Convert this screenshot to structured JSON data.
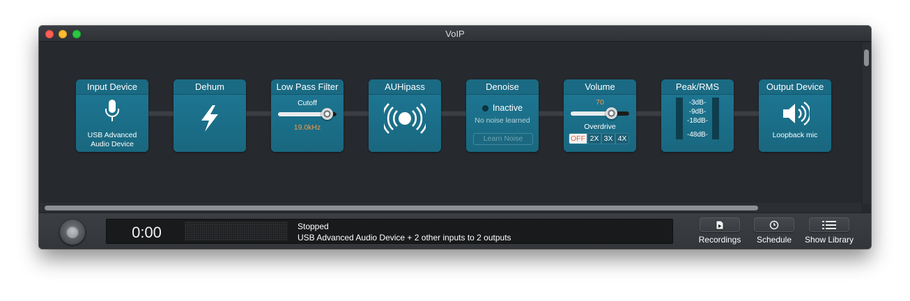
{
  "window": {
    "title": "VoIP"
  },
  "blocks": {
    "input_device": {
      "title": "Input Device",
      "device_line1": "USB Advanced",
      "device_line2": "Audio Device",
      "icon": "microphone-icon"
    },
    "dehum": {
      "title": "Dehum",
      "icon": "lightning-bolt-icon"
    },
    "low_pass_filter": {
      "title": "Low Pass Filter",
      "param_label": "Cutoff",
      "value": "19.0kHz",
      "slider_fraction": 0.84
    },
    "auhipass": {
      "title": "AUHipass",
      "icon": "broadcast-icon"
    },
    "denoise": {
      "title": "Denoise",
      "state": "Inactive",
      "info": "No noise learned",
      "button": "Learn Noise"
    },
    "volume": {
      "title": "Volume",
      "value": "70",
      "slider_fraction": 0.7,
      "overdrive_label": "Overdrive",
      "overdrive_options": [
        "OFF",
        "2X",
        "3X",
        "4X"
      ],
      "overdrive_selected": "OFF"
    },
    "peak_rms": {
      "title": "Peak/RMS",
      "labels": [
        "-3dB-",
        "-9dB-",
        "-18dB-",
        "-48dB-"
      ]
    },
    "output_device": {
      "title": "Output Device",
      "device": "Loopback mic",
      "icon": "speaker-icon"
    }
  },
  "status": {
    "time": "0:00",
    "state": "Stopped",
    "summary": "USB Advanced Audio Device + 2 other inputs to 2 outputs"
  },
  "toolbar": {
    "recordings": "Recordings",
    "schedule": "Schedule",
    "show_library": "Show Library"
  },
  "colors": {
    "block_bg": "#1d7089",
    "accent_orange": "#f39a48",
    "window_bg": "#26292d"
  }
}
